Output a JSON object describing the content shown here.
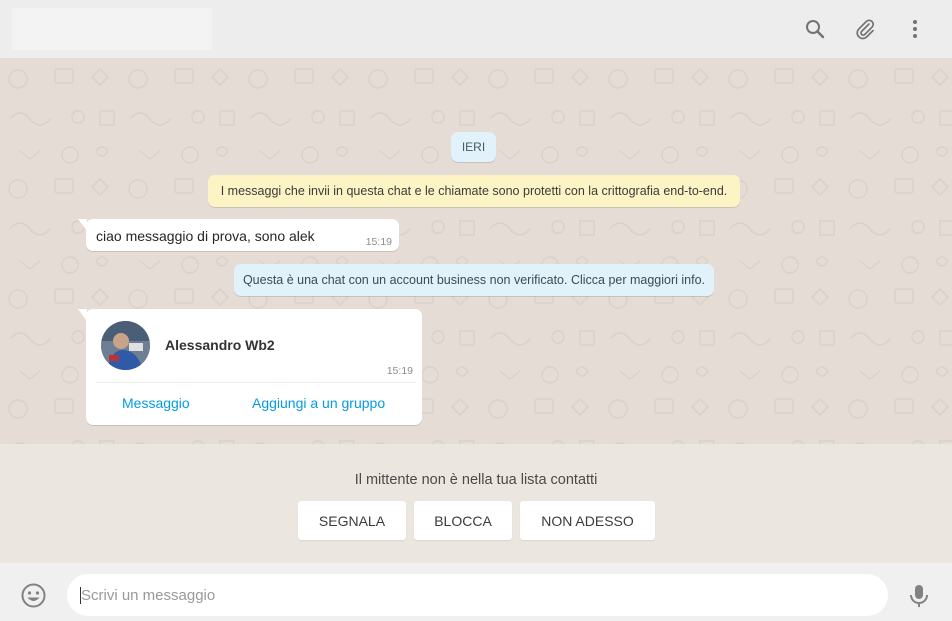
{
  "header": {
    "icons": [
      "search-icon",
      "attach-icon",
      "menu-icon"
    ]
  },
  "chat": {
    "date_label": "IERI",
    "encryption_notice": "I messaggi che invii in questa chat e le chiamate sono protetti con la crittografia end-to-end.",
    "messages": [
      {
        "text": "ciao messaggio di prova, sono alek",
        "time": "15:19"
      }
    ],
    "business_notice": "Questa è una chat con un account business non verificato. Clicca per maggiori info.",
    "contact_card": {
      "name": "Alessandro Wb2",
      "time": "15:19",
      "action_message": "Messaggio",
      "action_add_group": "Aggiungi a un gruppo"
    }
  },
  "unknown_sender": {
    "text": "Il mittente non è nella tua lista contatti",
    "report_label": "SEGNALA",
    "block_label": "BLOCCA",
    "not_now_label": "NON ADESSO"
  },
  "composer": {
    "placeholder": "Scrivi un messaggio",
    "value": ""
  },
  "colors": {
    "link": "#039be5",
    "encrypt_bg": "#fdf4c5",
    "system_bg": "#e1f2fb",
    "chat_bg": "#e5ddd5"
  }
}
